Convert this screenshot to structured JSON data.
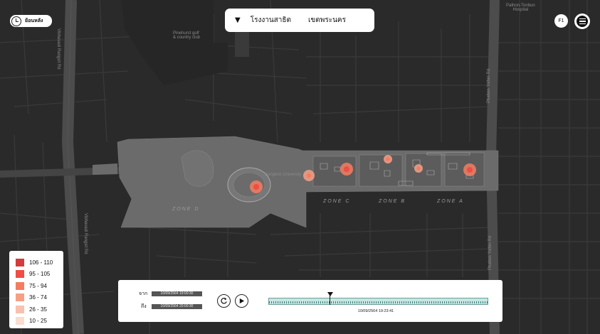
{
  "header": {
    "back_label": "ย้อนหลัง",
    "site_name": "โรงงานสาธิต",
    "district": "เขตพระนคร",
    "floor": "F1"
  },
  "map_labels": {
    "golf": "Pinehurst golf\n& country club",
    "university": "Bangkok University",
    "hospital": "Pathon-Tonbun\nHospital",
    "road_right": "Phahon Yothin Rd",
    "road_right2": "Phahon Yothin Rd",
    "road_left": "Vibhavadi Rangsit Rd",
    "road_left2": "Vibhavadi Rangsit Rd"
  },
  "zones": [
    "ZONE D",
    "ZONE C",
    "ZONE B",
    "ZONE A"
  ],
  "legend": [
    {
      "range": "106 - 110",
      "color": "#d63a3a"
    },
    {
      "range": "95 - 105",
      "color": "#ee4e44"
    },
    {
      "range": "75 - 94",
      "color": "#f47c61"
    },
    {
      "range": "36 - 74",
      "color": "#f79f86"
    },
    {
      "range": "26 - 35",
      "color": "#f9c0ad"
    },
    {
      "range": "10 - 25",
      "color": "#fcdcd0"
    }
  ],
  "playback": {
    "from_label": "จาก",
    "from_value": "10/09/2564 19:00:30",
    "to_label": "ถึง",
    "to_value": "10/09/2564 20:00:30",
    "current_time": "10/09/2564 19:23:41",
    "progress": 0.28
  }
}
